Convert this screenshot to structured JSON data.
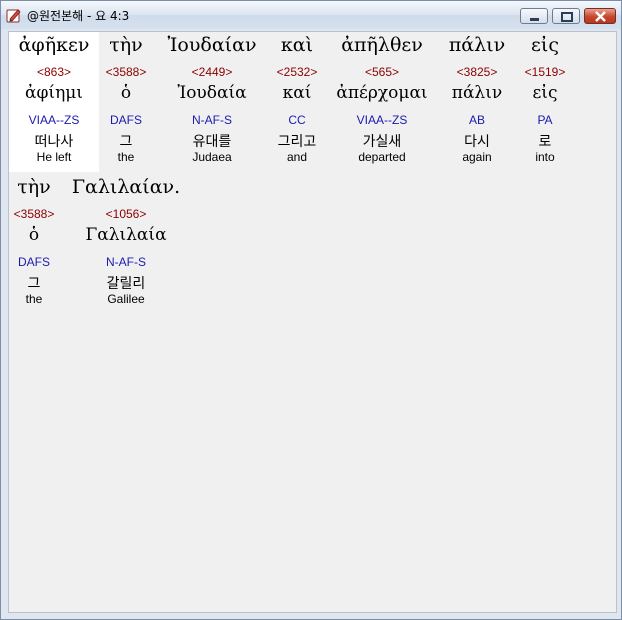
{
  "window": {
    "title": "@원전본해 - 요 4:3"
  },
  "words": [
    {
      "greek": "ἀφῆκεν",
      "strongs": "<863>",
      "lemma": "ἀφίημι",
      "parse": "VIAA--ZS",
      "korean": "떠나사",
      "english": "He left"
    },
    {
      "greek": "τὴν",
      "strongs": "<3588>",
      "lemma": "ὁ",
      "parse": "DAFS",
      "korean": "그",
      "english": "the"
    },
    {
      "greek": "Ἰουδαίαν",
      "strongs": "<2449>",
      "lemma": "Ἰουδαία",
      "parse": "N-AF-S",
      "korean": "유대를",
      "english": "Judaea"
    },
    {
      "greek": "καὶ",
      "strongs": "<2532>",
      "lemma": "καί",
      "parse": "CC",
      "korean": "그리고",
      "english": "and"
    },
    {
      "greek": "ἀπῆλθεν",
      "strongs": "<565>",
      "lemma": "ἀπέρχομαι",
      "parse": "VIAA--ZS",
      "korean": "가실새",
      "english": "departed"
    },
    {
      "greek": "πάλιν",
      "strongs": "<3825>",
      "lemma": "πάλιν",
      "parse": "AB",
      "korean": "다시",
      "english": "again"
    },
    {
      "greek": "εἰς",
      "strongs": "<1519>",
      "lemma": "εἰς",
      "parse": "PA",
      "korean": "로",
      "english": "into"
    },
    {
      "greek": "τὴν",
      "strongs": "<3588>",
      "lemma": "ὁ",
      "parse": "DAFS",
      "korean": "그",
      "english": "the"
    },
    {
      "greek": "Γαλιλαίαν.",
      "strongs": "<1056>",
      "lemma": "Γαλιλαία",
      "parse": "N-AF-S",
      "korean": "갈릴리",
      "english": "Galilee"
    }
  ],
  "colors": {
    "strongs": "#8b0000",
    "parse": "#1a1ab0",
    "selected_bg": "#ffffff",
    "content_bg": "#f0f0f0"
  }
}
